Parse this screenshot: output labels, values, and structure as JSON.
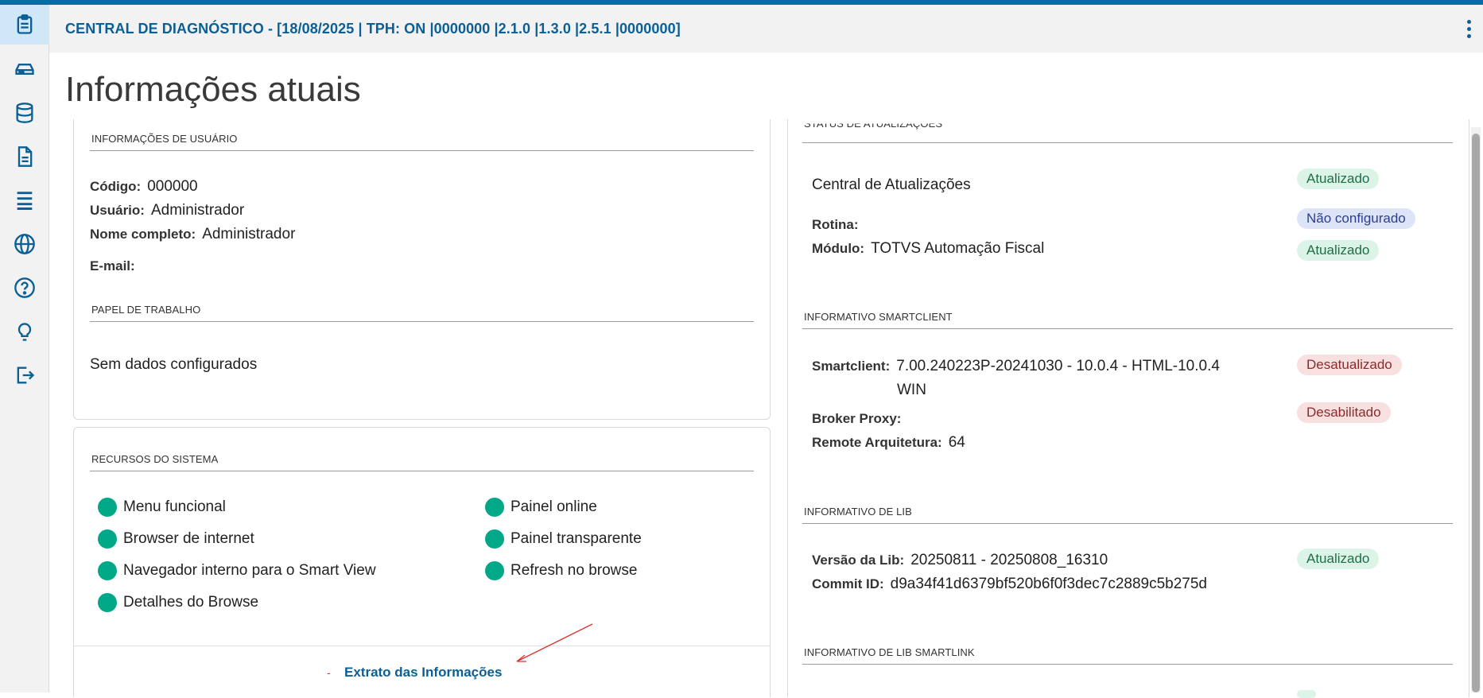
{
  "header": {
    "title": "CENTRAL DE DIAGNÓSTICO - [18/08/2025 | TPH: ON |0000000 |2.1.0 |1.3.0 |2.5.1 |0000000]"
  },
  "page": {
    "title": "Informações atuais"
  },
  "sidebar": {
    "items": [
      {
        "icon": "clipboard-icon",
        "active": true
      },
      {
        "icon": "hard-drive-icon"
      },
      {
        "icon": "database-icon"
      },
      {
        "icon": "document-icon"
      },
      {
        "icon": "server-icon"
      },
      {
        "icon": "globe-icon"
      },
      {
        "icon": "help-icon"
      },
      {
        "icon": "lightbulb-icon"
      },
      {
        "icon": "logout-icon"
      }
    ]
  },
  "user_info": {
    "title": "INFORMAÇÕES DE USUÁRIO",
    "codigo_label": "Código:",
    "codigo_value": "000000",
    "usuario_label": "Usuário:",
    "usuario_value": "Administrador",
    "nome_label": "Nome completo:",
    "nome_value": "Administrador",
    "email_label": "E-mail:",
    "email_value": ""
  },
  "work_role": {
    "title": "PAPEL DE TRABALHO",
    "empty_text": "Sem dados configurados"
  },
  "system_resources": {
    "title": "RECURSOS DO SISTEMA",
    "left": [
      "Menu funcional",
      "Browser de internet",
      "Navegador interno para o Smart View",
      "Detalhes do Browse"
    ],
    "right": [
      "Painel online",
      "Painel transparente",
      "Refresh no browse"
    ],
    "status_color": "#00a887"
  },
  "footer": {
    "dash": "-",
    "link": "Extrato das Informações"
  },
  "updates": {
    "title": "STATUS DE ATUALIZAÇÕES",
    "central_label": "Central de Atualizações",
    "central_status": "Atualizado",
    "rotina_label": "Rotina:",
    "rotina_status": "Não configurado",
    "modulo_label": "Módulo:",
    "modulo_value": "TOTVS Automação Fiscal",
    "modulo_status": "Atualizado"
  },
  "smartclient": {
    "title": "INFORMATIVO SMARTCLIENT",
    "smartclient_label": "Smartclient:",
    "smartclient_value_line1": "7.00.240223P-20241030 - 10.0.4 - HTML-10.0.4",
    "smartclient_value_line2": "WIN",
    "smartclient_status": "Desatualizado",
    "broker_label": "Broker Proxy:",
    "broker_status": "Desabilitado",
    "arquitetura_label": "Remote Arquitetura:",
    "arquitetura_value": "64"
  },
  "lib": {
    "title": "INFORMATIVO DE LIB",
    "versao_label": "Versão da Lib:",
    "versao_value": "20250811 - 20250808_16310",
    "versao_status": "Atualizado",
    "commit_label": "Commit ID:",
    "commit_value": "d9a34f41d6379bf520b6f0f3dec7c2889c5b275d"
  },
  "lib_smartlink": {
    "title": "INFORMATIVO DE LIB SMARTLINK"
  }
}
